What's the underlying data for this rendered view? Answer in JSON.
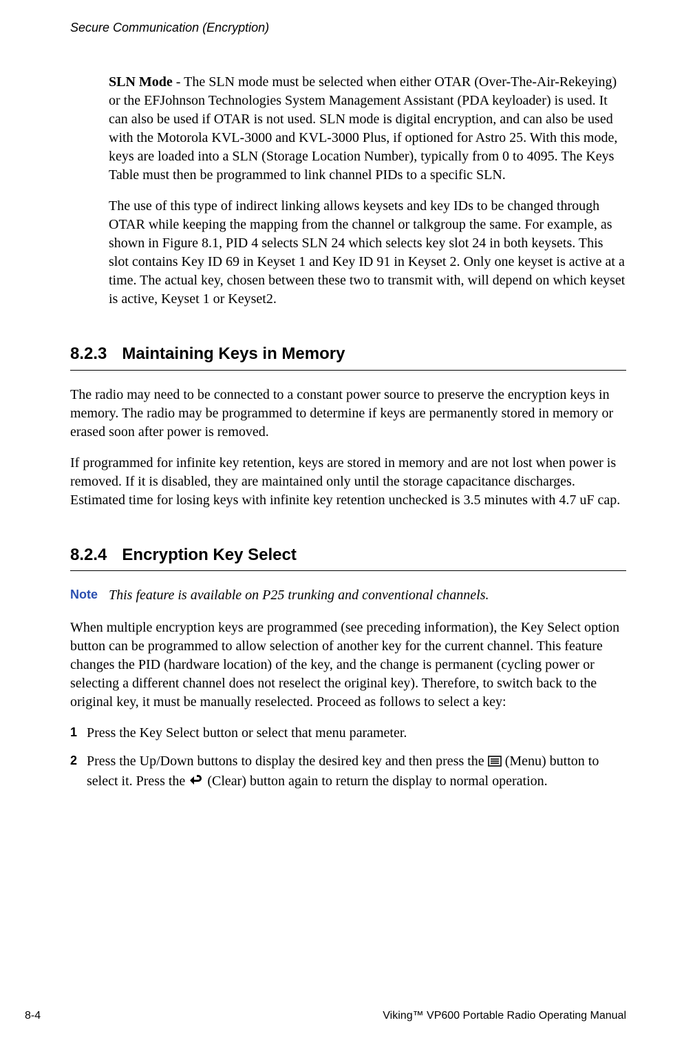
{
  "running_head": "Secure Communication (Encryption)",
  "sln": {
    "lead": "SLN Mode",
    "para1_rest": " - The SLN mode must be selected when either OTAR (Over-The-Air-Rekeying) or the EFJohnson Technologies System Management Assistant (PDA keyloader) is used. It can also be used if OTAR is not used. SLN mode is digital encryption, and can also be used with the Motorola KVL-3000 and KVL-3000 Plus, if optioned for Astro 25. With this mode, keys are loaded into a SLN (Storage Location Number), typically from 0 to 4095. The Keys Table must then be programmed to link channel PIDs to a specific SLN.",
    "para2": "The use of this type of indirect linking allows keysets and key IDs to be changed through OTAR while keeping the mapping from the channel or talkgroup the same. For example, as shown in Figure 8.1, PID 4 selects SLN 24 which selects key slot 24 in both keysets. This slot contains Key ID 69 in Keyset 1 and Key ID 91 in Keyset 2. Only one keyset is active at a time. The actual key, chosen between these two to transmit with, will depend on which keyset is active, Keyset 1 or Keyset2."
  },
  "sec823": {
    "num": "8.2.3",
    "title": "Maintaining Keys in Memory",
    "para1": "The radio may need to be connected to a constant power source to preserve the encryption keys in memory. The radio may be programmed to determine if keys are permanently stored in memory or erased soon after power is removed.",
    "para2": "If programmed for infinite key retention, keys are stored in memory and are not lost when power is removed. If it is disabled, they are maintained only until the storage capacitance discharges. Estimated time for losing keys with infinite key retention unchecked is 3.5 minutes with 4.7 uF cap."
  },
  "sec824": {
    "num": "8.2.4",
    "title": "Encryption Key Select",
    "note_label": "Note",
    "note_text": "This feature is available on P25 trunking and conventional channels.",
    "para1": "When multiple encryption keys are programmed (see preceding information), the Key Select option button can be programmed to allow selection of another key for the current channel. This feature changes the PID (hardware location) of the key, and the change is permanent (cycling power or selecting a different channel does not reselect the original key). Therefore, to switch back to the original key, it must be manually reselected. Proceed as follows to select a key:",
    "steps": [
      {
        "num": "1",
        "text": "Press the Key Select button or select that menu parameter."
      },
      {
        "num": "2",
        "pre": "Press the Up/Down buttons to display the desired key and then press the ",
        "mid": " (Menu) button to select it. Press the ",
        "post": " (Clear) button again to return the display to normal operation."
      }
    ]
  },
  "footer": {
    "page": "8-4",
    "title": "Viking™ VP600 Portable Radio Operating Manual"
  }
}
